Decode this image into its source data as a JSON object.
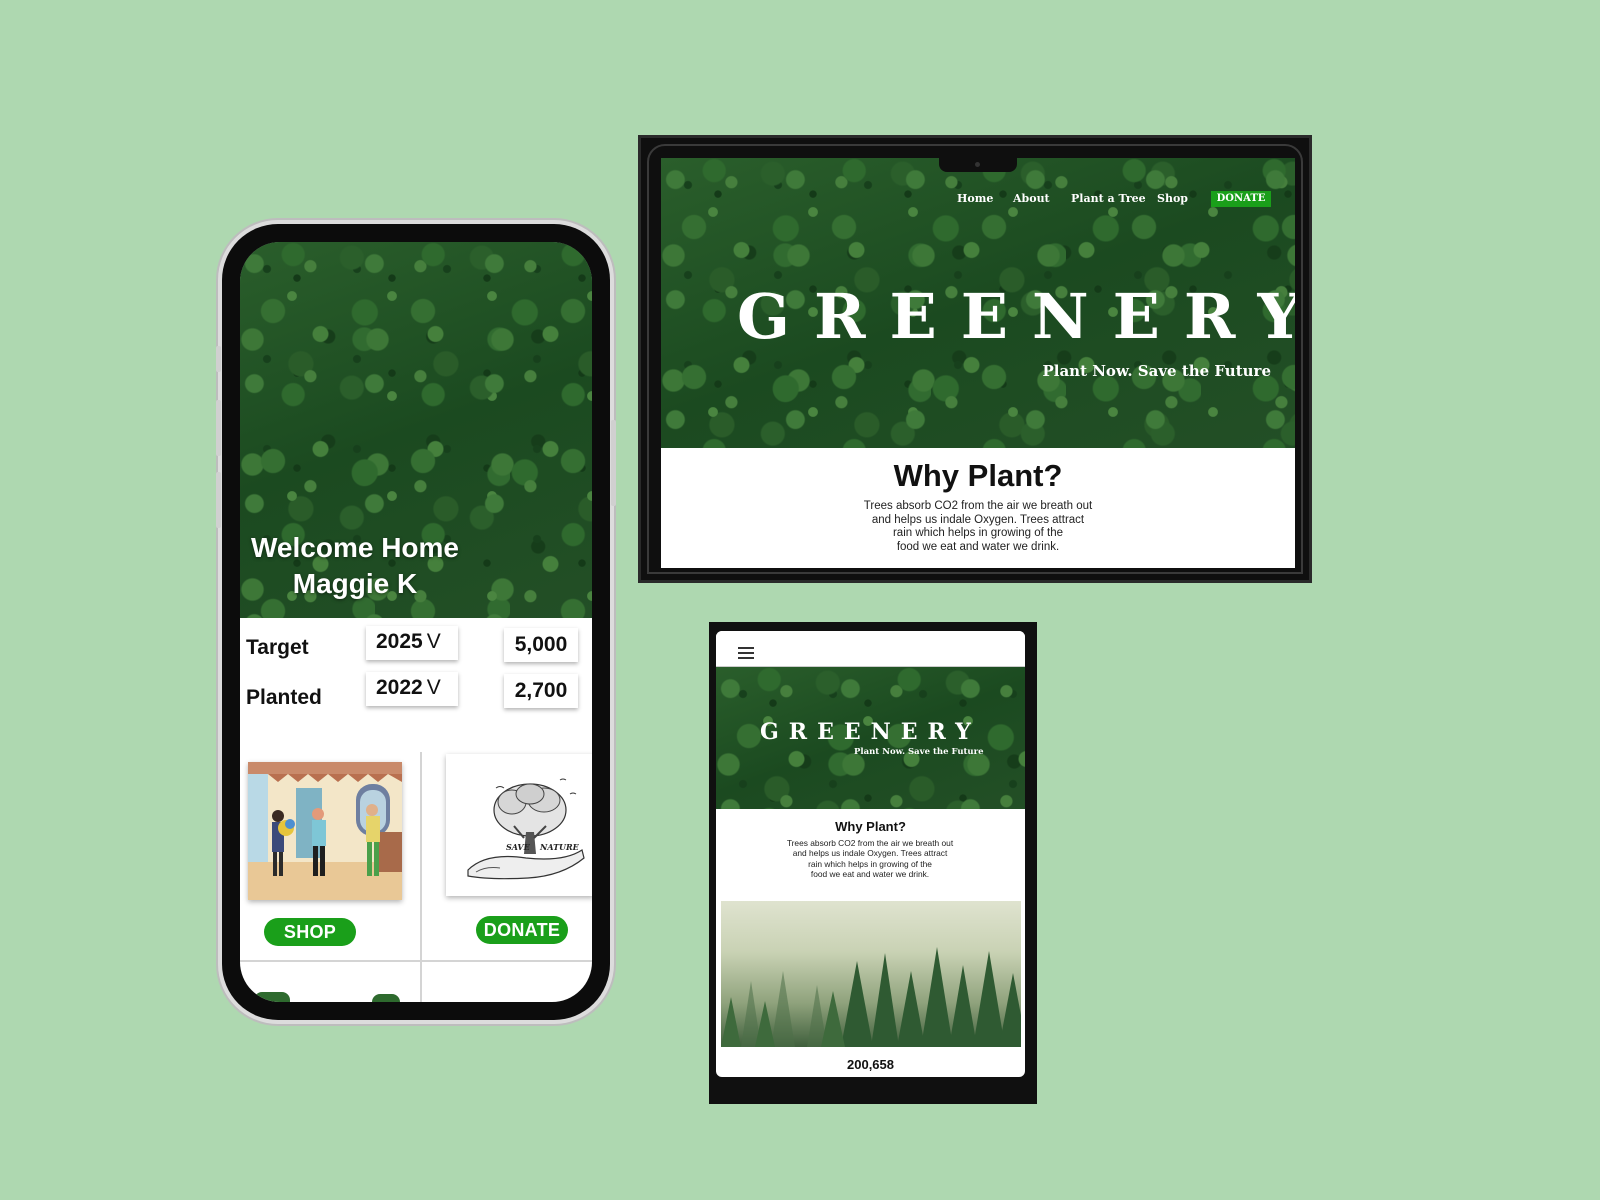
{
  "phone": {
    "welcome_line1": "Welcome Home",
    "welcome_line2": "Maggie K",
    "stats": [
      {
        "label": "Target",
        "year": "2025",
        "value": "5,000"
      },
      {
        "label": "Planted",
        "year": "2022",
        "value": "2,700"
      }
    ],
    "year_chevron": "V",
    "shop_label": "SHOP",
    "donate_label": "DONATE",
    "illustration_text_left": "SAVE",
    "illustration_text_right": "NATURE"
  },
  "laptop": {
    "nav": [
      "Home",
      "About",
      "Plant a Tree",
      "Shop"
    ],
    "donate_label": "DONATE",
    "title": "GREENERY",
    "tagline": "Plant Now. Save the Future",
    "why_title": "Why Plant?",
    "why_lines": [
      "Trees absorb CO2 from the air we breath out",
      "and helps us indale Oxygen. Trees attract",
      "rain which helps in growing of the",
      "food we eat and water we drink."
    ]
  },
  "tablet": {
    "title": "GREENERY",
    "tagline": "Plant Now. Save the Future",
    "why_title": "Why Plant?",
    "why_lines": [
      "Trees absorb CO2 from the air we breath out",
      "and helps us indale Oxygen. Trees attract",
      "rain which helps in growing of the",
      "food we eat and water we drink."
    ],
    "count": "200,658"
  },
  "colors": {
    "background": "#aed8b0",
    "accent_green": "#1a9f1a",
    "device_frame": "#0c0c0c"
  }
}
